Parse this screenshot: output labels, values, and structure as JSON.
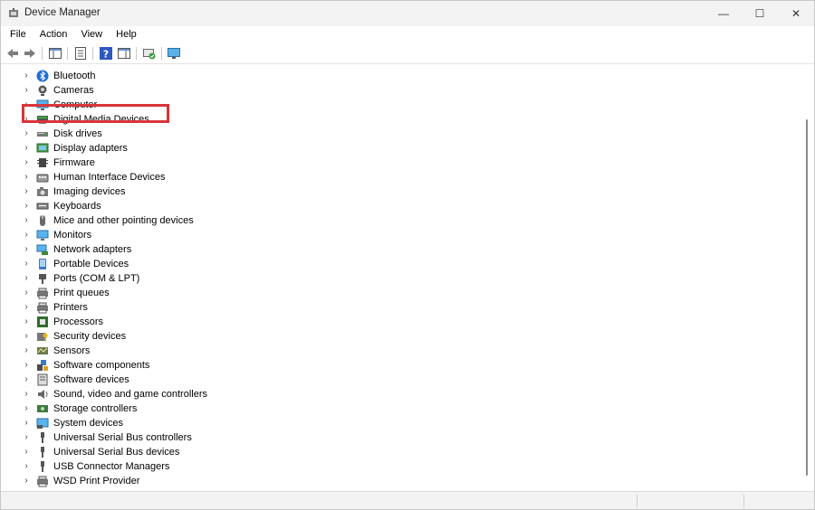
{
  "window": {
    "title": "Device Manager",
    "controls": {
      "minimize": "—",
      "maximize": "☐",
      "close": "✕"
    }
  },
  "menu": [
    "File",
    "Action",
    "View",
    "Help"
  ],
  "toolbar": {
    "buttons": [
      "back-arrow-icon",
      "forward-arrow-icon",
      "show-hide-console-tree-icon",
      "properties-icon",
      "help-icon",
      "action-pane-icon",
      "scan-hardware-icon",
      "monitor-icon"
    ]
  },
  "tree": {
    "expander_glyph": "›",
    "selected_index": 7,
    "highlight_color": "#d9343b",
    "items": [
      {
        "label": "Bluetooth",
        "icon": "bluetooth-icon"
      },
      {
        "label": "Cameras",
        "icon": "camera-icon"
      },
      {
        "label": "Computer",
        "icon": "computer-icon"
      },
      {
        "label": "Digital Media Devices",
        "icon": "media-device-icon"
      },
      {
        "label": "Disk drives",
        "icon": "disk-drive-icon"
      },
      {
        "label": "Display adapters",
        "icon": "display-adapter-icon"
      },
      {
        "label": "Firmware",
        "icon": "firmware-icon"
      },
      {
        "label": "Human Interface Devices",
        "icon": "hid-icon"
      },
      {
        "label": "Imaging devices",
        "icon": "imaging-icon"
      },
      {
        "label": "Keyboards",
        "icon": "keyboard-icon"
      },
      {
        "label": "Mice and other pointing devices",
        "icon": "mouse-icon"
      },
      {
        "label": "Monitors",
        "icon": "monitor-icon"
      },
      {
        "label": "Network adapters",
        "icon": "network-adapter-icon"
      },
      {
        "label": "Portable Devices",
        "icon": "portable-device-icon"
      },
      {
        "label": "Ports (COM & LPT)",
        "icon": "port-icon"
      },
      {
        "label": "Print queues",
        "icon": "print-queue-icon"
      },
      {
        "label": "Printers",
        "icon": "printer-icon"
      },
      {
        "label": "Processors",
        "icon": "processor-icon"
      },
      {
        "label": "Security devices",
        "icon": "security-device-icon"
      },
      {
        "label": "Sensors",
        "icon": "sensor-icon"
      },
      {
        "label": "Software components",
        "icon": "software-component-icon"
      },
      {
        "label": "Software devices",
        "icon": "software-device-icon"
      },
      {
        "label": "Sound, video and game controllers",
        "icon": "sound-icon"
      },
      {
        "label": "Storage controllers",
        "icon": "storage-controller-icon"
      },
      {
        "label": "System devices",
        "icon": "system-device-icon"
      },
      {
        "label": "Universal Serial Bus controllers",
        "icon": "usb-controller-icon"
      },
      {
        "label": "Universal Serial Bus devices",
        "icon": "usb-device-icon"
      },
      {
        "label": "USB Connector Managers",
        "icon": "usb-connector-icon"
      },
      {
        "label": "WSD Print Provider",
        "icon": "wsd-print-icon"
      }
    ]
  }
}
